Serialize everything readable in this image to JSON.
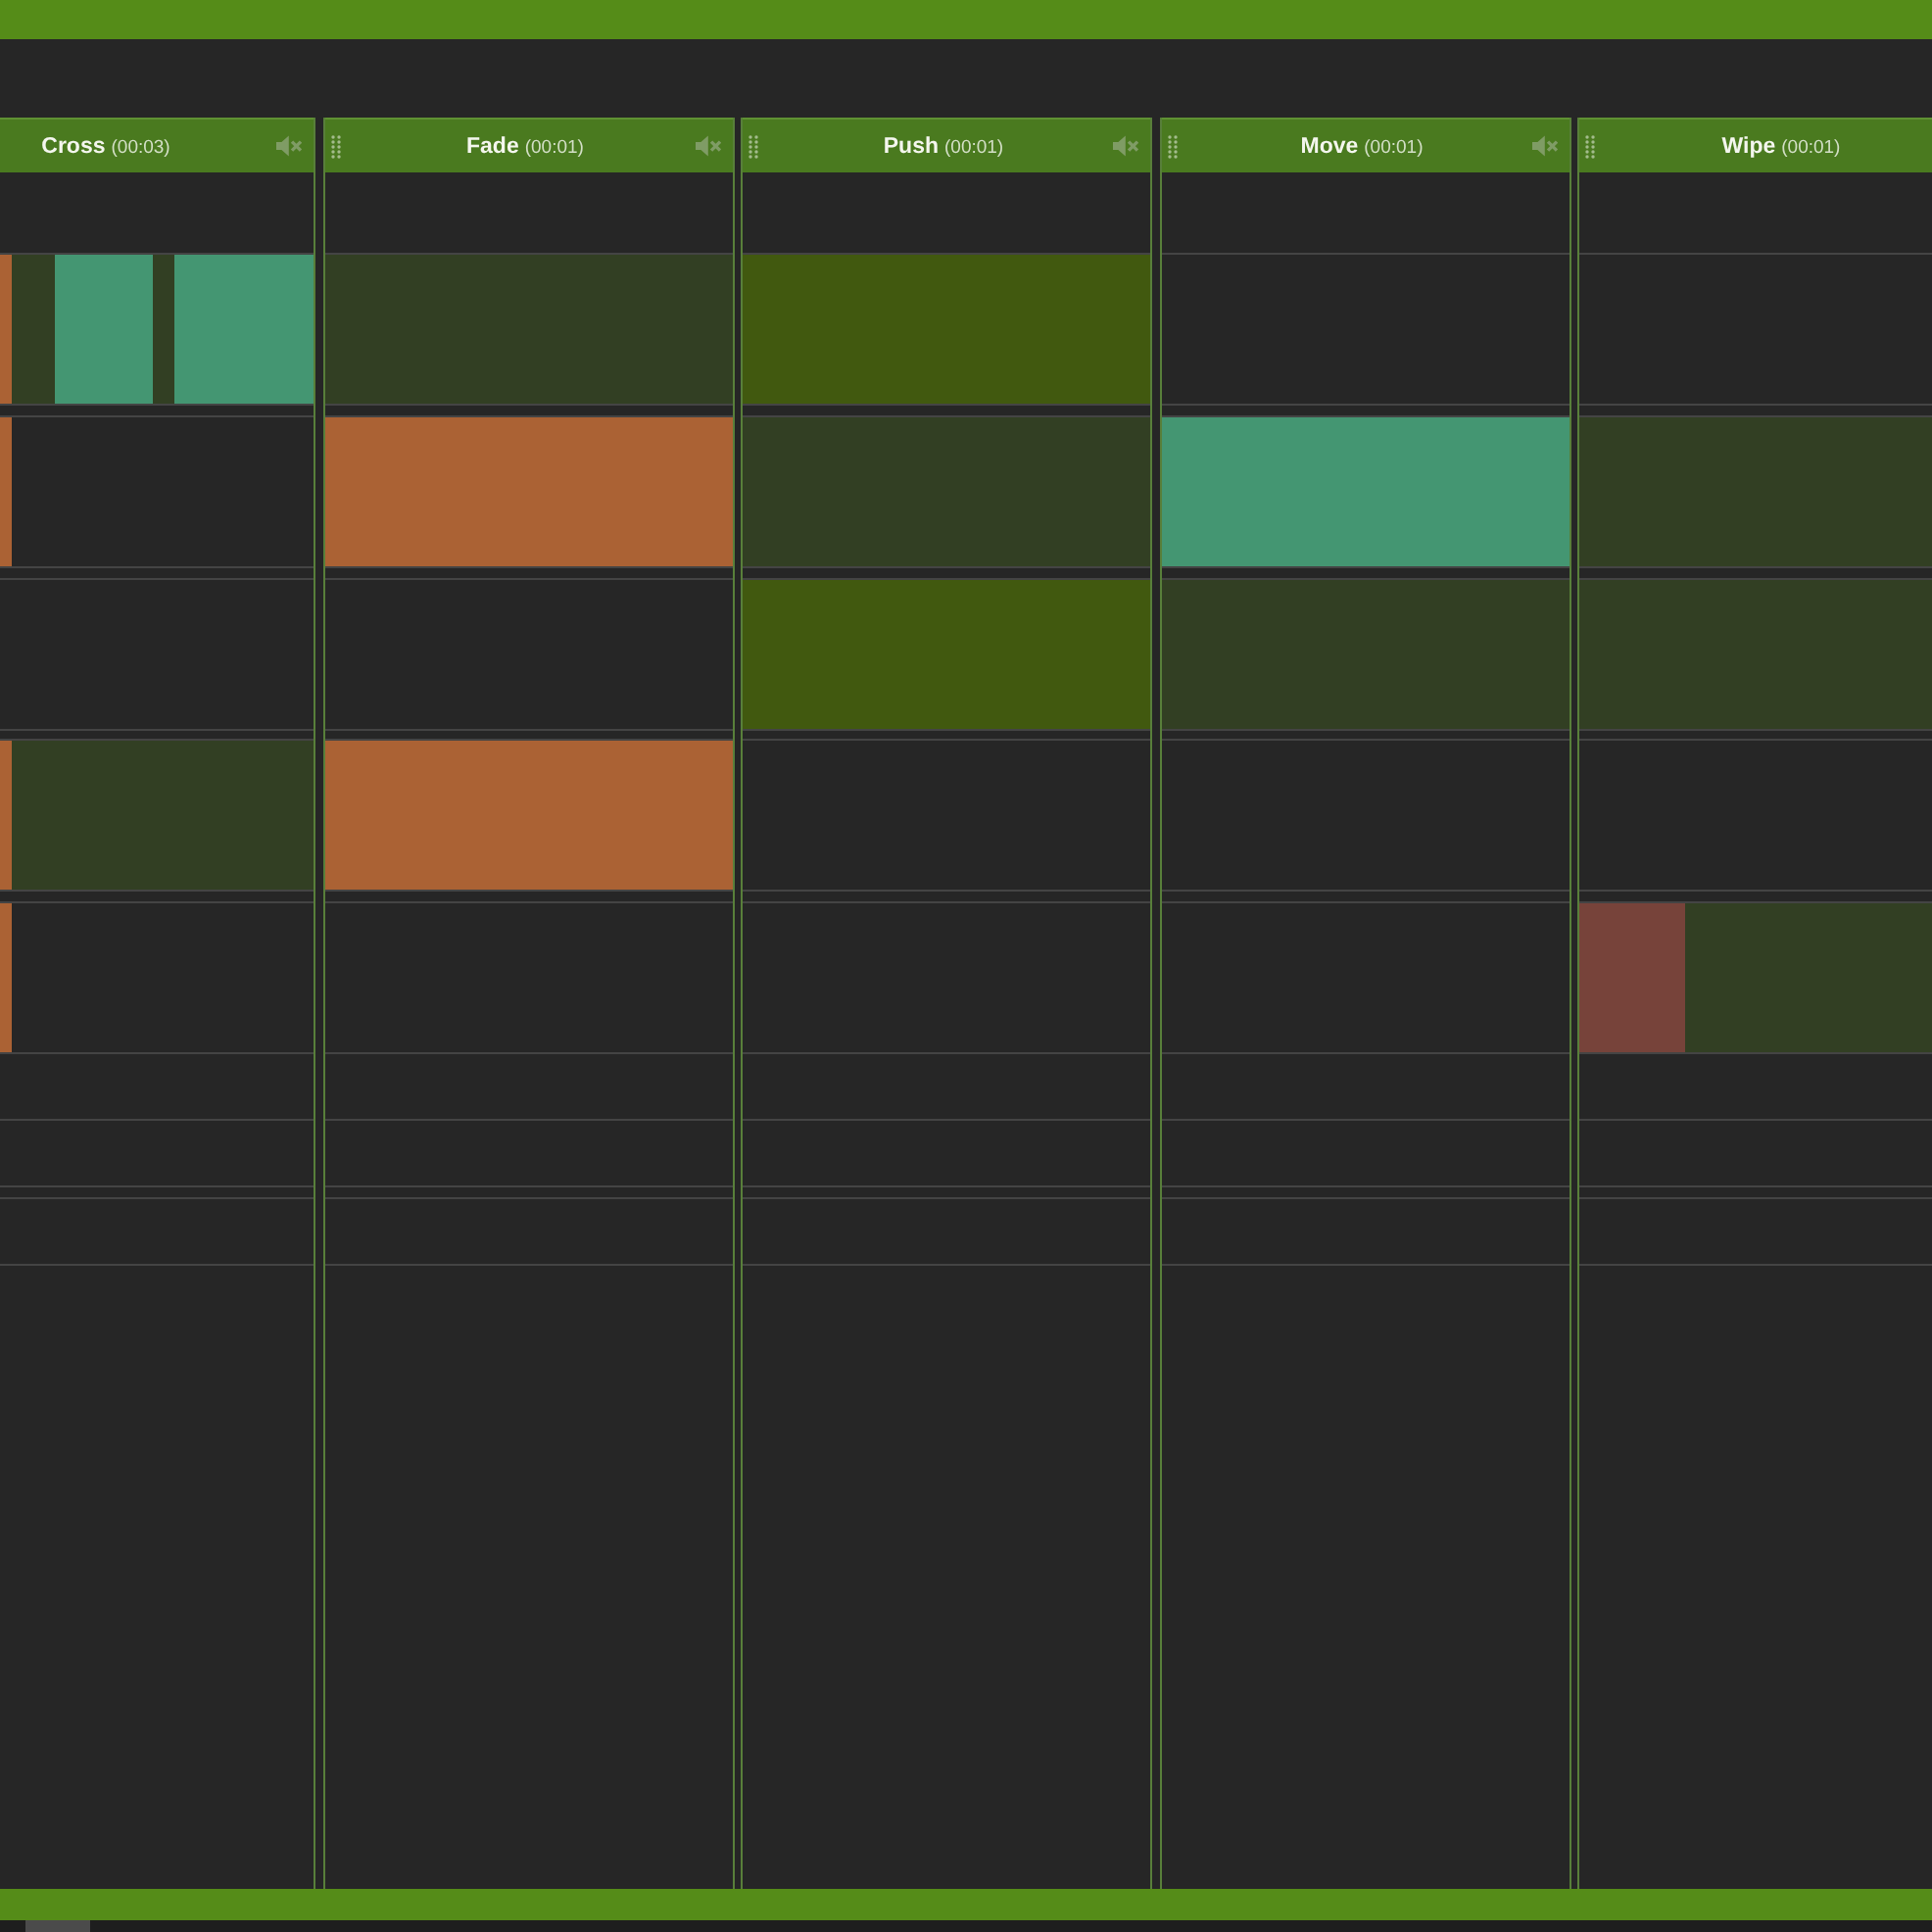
{
  "columns": [
    {
      "title": "Cross",
      "duration": "(00:03)",
      "rows": [
        {
          "segments": [
            {
              "kind": "edge",
              "color": "#ab6234"
            },
            {
              "kind": "short",
              "color": "#323f23"
            },
            {
              "kind": "mid",
              "color": "#449672"
            },
            {
              "kind": "gap",
              "color": "#323f23"
            },
            {
              "kind": "fill",
              "color": "#449672"
            }
          ]
        },
        {
          "segments": [
            {
              "kind": "edge",
              "color": "#ab6234"
            }
          ]
        },
        {},
        {
          "segments": [
            {
              "kind": "edge",
              "color": "#ab6234"
            },
            {
              "kind": "fill",
              "color": "#323f23"
            }
          ]
        },
        {
          "segments": [
            {
              "kind": "edge",
              "color": "#ab6234"
            }
          ]
        }
      ]
    },
    {
      "title": "Fade",
      "duration": "(00:01)",
      "rows": [
        {
          "segments": [
            {
              "kind": "fill",
              "color": "#323f23"
            }
          ]
        },
        {
          "segments": [
            {
              "kind": "fill",
              "color": "#ab6234"
            }
          ]
        },
        {},
        {
          "segments": [
            {
              "kind": "fill",
              "color": "#ab6234"
            }
          ]
        },
        {}
      ]
    },
    {
      "title": "Push",
      "duration": "(00:01)",
      "rows": [
        {
          "segments": [
            {
              "kind": "fill",
              "color": "#41590f"
            }
          ]
        },
        {
          "segments": [
            {
              "kind": "fill",
              "color": "#323f23"
            }
          ]
        },
        {
          "segments": [
            {
              "kind": "fill",
              "color": "#41590f"
            }
          ]
        },
        {},
        {}
      ]
    },
    {
      "title": "Move",
      "duration": "(00:01)",
      "rows": [
        {},
        {
          "segments": [
            {
              "kind": "fill",
              "color": "#449672"
            }
          ]
        },
        {
          "segments": [
            {
              "kind": "fill",
              "color": "#323f23"
            }
          ]
        },
        {},
        {}
      ]
    },
    {
      "title": "Wipe",
      "duration": "(00:01)",
      "rows": [
        {},
        {
          "segments": [
            {
              "kind": "fill",
              "color": "#323f23"
            }
          ]
        },
        {
          "segments": [
            {
              "kind": "fill",
              "color": "#323f23"
            }
          ]
        },
        {},
        {
          "segments": [
            {
              "kind": "lead",
              "color": "#77433a"
            },
            {
              "kind": "fill",
              "color": "#323f23"
            }
          ]
        }
      ]
    }
  ]
}
